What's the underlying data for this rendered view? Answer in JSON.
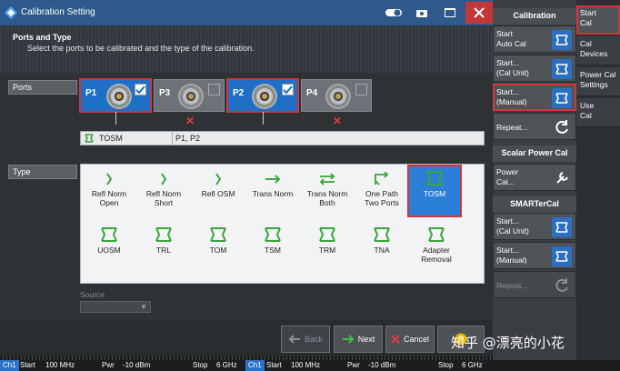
{
  "window": {
    "title": "Calibration Setting",
    "close_icon": "close-icon"
  },
  "header": {
    "title": "Ports and Type",
    "subtitle": "Select the ports to be calibrated and the type of the calibration."
  },
  "ports_section": {
    "label": "Ports",
    "ports": [
      {
        "label": "P1",
        "checked": true
      },
      {
        "label": "P3",
        "checked": false
      },
      {
        "label": "P2",
        "checked": true
      },
      {
        "label": "P4",
        "checked": false
      }
    ],
    "summary_type": "TOSM",
    "summary_ports": "P1, P2"
  },
  "type_section": {
    "label": "Type",
    "row1": [
      "Refl Norm Open",
      "Refl Norm Short",
      "Refl OSM",
      "Trans Norm",
      "Trans Norm Both",
      "One Path Two Ports",
      "TOSM"
    ],
    "row1_lines": [
      [
        "Refl Norm",
        "Open"
      ],
      [
        "Refl Norm",
        "Short"
      ],
      [
        "Refl OSM",
        ""
      ],
      [
        "Trans Norm",
        ""
      ],
      [
        "Trans Norm",
        "Both"
      ],
      [
        "One Path",
        "Two Ports"
      ],
      [
        "TOSM",
        ""
      ]
    ],
    "row2_lines": [
      [
        "UOSM",
        ""
      ],
      [
        "TRL",
        ""
      ],
      [
        "TOM",
        ""
      ],
      [
        "TSM",
        ""
      ],
      [
        "TRM",
        ""
      ],
      [
        "TNA",
        ""
      ],
      [
        "Adapter",
        "Removal"
      ]
    ],
    "selected": "TOSM"
  },
  "source": {
    "label": "Source",
    "value": ""
  },
  "buttons": {
    "back": "Back",
    "next": "Next",
    "cancel": "Cancel"
  },
  "softkeys": {
    "calibration_header": "Calibration",
    "start_auto_cal": [
      "Start",
      "Auto Cal"
    ],
    "start_cal_unit": [
      "Start...",
      "(Cal Unit)"
    ],
    "start_manual": [
      "Start...",
      "(Manual)"
    ],
    "repeat": "Repeat...",
    "scalar_header": "Scalar Power Cal",
    "power_cal": [
      "Power",
      "Cal..."
    ],
    "smarter_header": "SMARTerCal",
    "smarter_cal_unit": [
      "Start...",
      "(Cal Unit)"
    ],
    "smarter_manual": [
      "Start...",
      "(Manual)"
    ],
    "smarter_repeat": "Repeat..."
  },
  "tabs": [
    [
      "Start",
      "Cal"
    ],
    [
      "Cal",
      "Devices"
    ],
    [
      "Power Cal",
      "Settings"
    ],
    [
      "Use",
      "Cal"
    ]
  ],
  "statusbar": {
    "ch1_a": {
      "ch": "Ch1",
      "start": "Start",
      "start_val": "100 MHz",
      "pwr": "Pwr",
      "pwr_val": "-10 dBm",
      "stop": "Stop",
      "stop_val": "6 GHz"
    },
    "ch1_b": {
      "ch": "Ch1",
      "start": "Start",
      "start_val": "100 MHz",
      "pwr": "Pwr",
      "pwr_val": "-10 dBm",
      "stop": "Stop",
      "stop_val": "6 GHz"
    }
  },
  "watermark": "知乎 @漂亮的小花",
  "colors": {
    "accent_blue": "#2c7fd6",
    "highlight_red": "#d3353b",
    "titlebar": "#2d5a8a"
  }
}
